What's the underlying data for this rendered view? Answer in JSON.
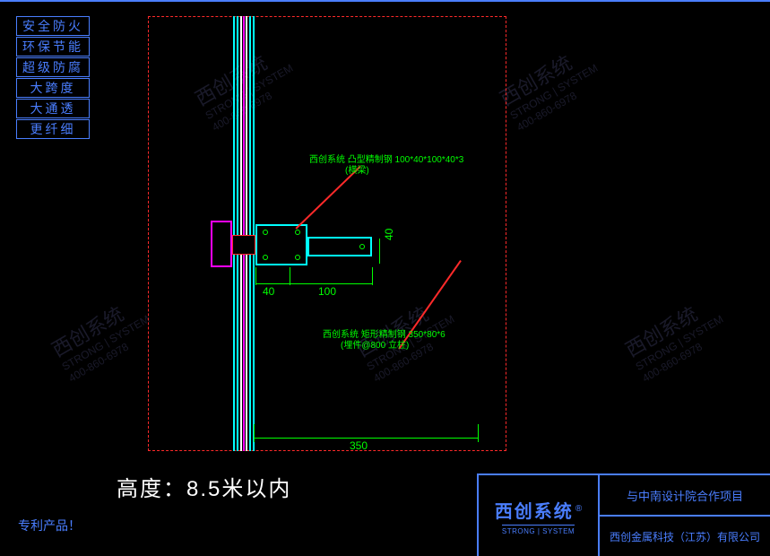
{
  "badges": [
    "安全防火",
    "环保节能",
    "超级防腐",
    "大跨度",
    "大通透",
    "更纤细"
  ],
  "patent_label": "专利产品！",
  "height_label": "高度：8.5米以内",
  "annotations": {
    "anno1_line1": "西创系统 凸型精制钢 100*40*100*40*3",
    "anno1_line2": "(横梁)",
    "anno2_line1": "西创系统 矩形精制钢 350*80*6",
    "anno2_line2": "(埋件@800 立柱)"
  },
  "dimensions": {
    "d40a": "40",
    "d100": "100",
    "d40b": "40",
    "d350": "350"
  },
  "title_block": {
    "logo_main": "西创系统",
    "logo_sub": "STRONG | SYSTEM",
    "logo_reg": "®",
    "project": "与中南设计院合作项目",
    "company": "西创金属科技（江苏）有限公司"
  },
  "watermark": {
    "main": "西创系统",
    "sub": "STRONG | SYSTEM",
    "phone": "400-860-6978"
  }
}
